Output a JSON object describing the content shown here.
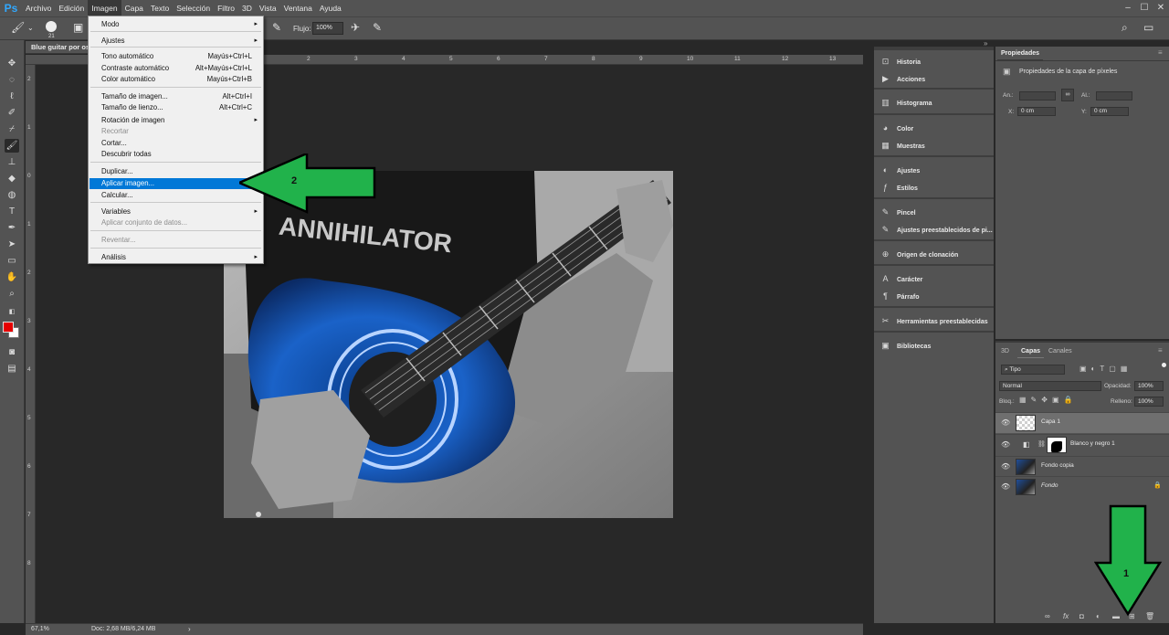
{
  "app": {
    "logo": "Ps"
  },
  "menubar": {
    "items": [
      "Archivo",
      "Edición",
      "Imagen",
      "Capa",
      "Texto",
      "Selección",
      "Filtro",
      "3D",
      "Vista",
      "Ventana",
      "Ayuda"
    ],
    "active": "Imagen"
  },
  "options": {
    "brush_size": "21",
    "flow_label": "Flujo:",
    "flow_value": "100%"
  },
  "document": {
    "tab_title": "Blue guitar por os"
  },
  "status": {
    "zoom": "67,1%",
    "doc": "Doc: 2,68 MB/6,24 MB"
  },
  "rulers": {
    "h_labels": [
      "1",
      "2",
      "3",
      "4",
      "5",
      "6",
      "7",
      "8",
      "9",
      "10",
      "11",
      "12",
      "13"
    ],
    "v_labels": [
      "2",
      "1",
      "0",
      "1",
      "2",
      "3",
      "4",
      "5",
      "6",
      "7",
      "8"
    ]
  },
  "image_menu": {
    "items": [
      {
        "label": "Modo",
        "submenu": true
      },
      {
        "label": "Ajustes",
        "submenu": true
      },
      {
        "label": "Tono automático",
        "shortcut": "Mayús+Ctrl+L"
      },
      {
        "label": "Contraste automático",
        "shortcut": "Alt+Mayús+Ctrl+L"
      },
      {
        "label": "Color automático",
        "shortcut": "Mayús+Ctrl+B"
      },
      {
        "label": "Tamaño de imagen...",
        "shortcut": "Alt+Ctrl+I"
      },
      {
        "label": "Tamaño de lienzo...",
        "shortcut": "Alt+Ctrl+C"
      },
      {
        "label": "Rotación de imagen",
        "submenu": true
      },
      {
        "label": "Recortar",
        "disabled": true
      },
      {
        "label": "Cortar..."
      },
      {
        "label": "Descubrir todas"
      },
      {
        "label": "Duplicar..."
      },
      {
        "label": "Aplicar imagen...",
        "highlighted": true
      },
      {
        "label": "Calcular..."
      },
      {
        "label": "Variables",
        "submenu": true
      },
      {
        "label": "Aplicar conjunto de datos...",
        "disabled": true
      },
      {
        "label": "Reventar...",
        "disabled": true
      },
      {
        "label": "Análisis",
        "submenu": true
      }
    ]
  },
  "panels_mid": {
    "items": [
      "Historia",
      "Acciones",
      "Histograma",
      "Color",
      "Muestras",
      "Ajustes",
      "Estilos",
      "Pincel",
      "Ajustes preestablecidos de pi...",
      "Origen de clonación",
      "Carácter",
      "Párrafo",
      "Herramientas preestablecidas",
      "Bibliotecas"
    ]
  },
  "properties": {
    "tab": "Propiedades",
    "title": "Propiedades de la capa de píxeles",
    "w_label": "An.:",
    "h_label": "Al.:",
    "x_label": "X:",
    "y_label": "Y:",
    "x_value": "0 cm",
    "y_value": "0 cm"
  },
  "layers": {
    "tabs": [
      "3D",
      "Capas",
      "Canales"
    ],
    "active_tab": "Capas",
    "filter": "Tipo",
    "blend": "Normal",
    "opacity_label": "Opacidad:",
    "opacity": "100%",
    "lock_label": "Bloq.:",
    "fill_label": "Relleno:",
    "fill": "100%",
    "rows": [
      {
        "name": "Capa 1",
        "selected": true
      },
      {
        "name": "Blanco y negro 1"
      },
      {
        "name": "Fondo copia"
      },
      {
        "name": "Fondo",
        "italic": true,
        "locked": true
      }
    ]
  },
  "annotations": {
    "arrow1_label": "1",
    "arrow2_label": "2",
    "arrow_color": "#21b24b"
  },
  "colors": {
    "foreground": "#e60000",
    "background": "#ffffff",
    "highlight": "#0078d7"
  }
}
